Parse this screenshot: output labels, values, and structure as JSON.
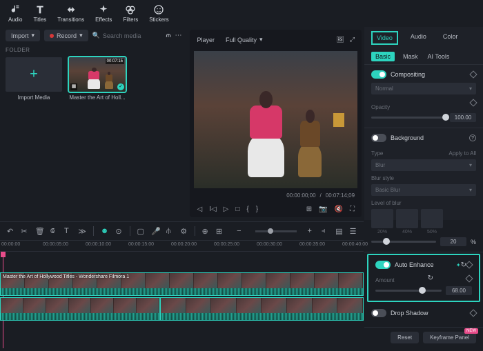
{
  "toolbar": {
    "audio": "Audio",
    "titles": "Titles",
    "transitions": "Transitions",
    "effects": "Effects",
    "filters": "Filters",
    "stickers": "Stickers"
  },
  "media": {
    "import": "Import",
    "record": "Record",
    "search_placeholder": "Search media",
    "folder": "FOLDER",
    "import_media": "Import Media",
    "clip_name": "Master the Art of Holl...",
    "duration": "00:07:15"
  },
  "preview": {
    "player": "Player",
    "quality": "Full Quality",
    "current": "00:00:00;00",
    "total": "00:07:14;09"
  },
  "right": {
    "tab_video": "Video",
    "tab_audio": "Audio",
    "tab_color": "Color",
    "sub_basic": "Basic",
    "sub_mask": "Mask",
    "sub_ai": "AI Tools",
    "compositing": "Compositing",
    "normal": "Normal",
    "opacity": "Opacity",
    "opacity_val": "100.00",
    "background": "Background",
    "type": "Type",
    "apply_all": "Apply to All",
    "blur": "Blur",
    "blur_style": "Blur style",
    "basic_blur": "Basic Blur",
    "level": "Level of blur",
    "b1": "20%",
    "b2": "40%",
    "b3": "50%",
    "blur_val": "20",
    "pct": "%",
    "auto_enhance": "Auto Enhance",
    "amount": "Amount",
    "amount_val": "68.00",
    "drop_shadow": "Drop Shadow",
    "reset": "Reset",
    "keyframe": "Keyframe Panel",
    "badge": "NEW"
  },
  "timeline": {
    "t0": "00:00:00",
    "t1": "00:00:05:00",
    "t2": "00:00:10:00",
    "t3": "00:00:15:00",
    "t4": "00:00:20:00",
    "t5": "00:00:25:00",
    "t6": "00:00:30:00",
    "t7": "00:00:35:00",
    "t8": "00:00:40:00",
    "clip1": "Master the Art of Hollywood Titles - Wondershare Filmora 1"
  }
}
